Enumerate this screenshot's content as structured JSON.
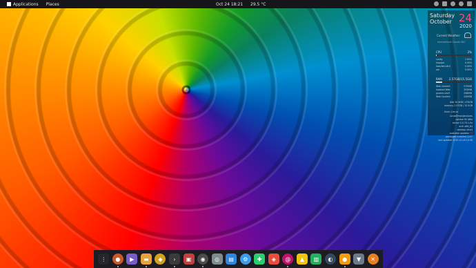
{
  "topbar": {
    "menu": [
      "Applications",
      "Places"
    ],
    "clock": "Oct 24  18:21",
    "weather": "29.5 °C"
  },
  "conky": {
    "day": "Saturday",
    "month": "October",
    "date": "24",
    "year": "2020",
    "weather_label": "Current Weather:",
    "weather_value": "Intermittent Clouds 30C",
    "cpu_label": "CPU",
    "cpu_percent": "2%",
    "cpu_fraction": 0.02,
    "procs": [
      {
        "name": "conky",
        "value": "2.60%"
      },
      {
        "name": "kswapd",
        "value": "0.00%"
      },
      {
        "name": "kworker/u8:0",
        "value": "0.00%"
      },
      {
        "name": "zsh",
        "value": "0.00%"
      }
    ],
    "ram_label": "RAM",
    "ram_value": "2.57GiB/15.5GiB",
    "ram_fraction": 0.17,
    "mem_procs": [
      {
        "name": "Web Content",
        "value": "570MiB"
      },
      {
        "name": "Isolated Web",
        "value": "353MiB"
      },
      {
        "name": "gnome-shell",
        "value": "298MiB"
      },
      {
        "name": "Web Content",
        "value": "240MiB"
      }
    ],
    "disk": "disk 30.6GB / 476GB",
    "memory": "memory 2.57GB / 15.5GB",
    "distro": "Arch Linux",
    "host": "lucas@manjarolucas",
    "uptime": "uptime 9h 48m",
    "kernel": "kernel 5.4.70-1-lts",
    "arch": "arch x86_64",
    "desktop": "desktop xfce4",
    "updates_label": "available updates",
    "updates_value": "73",
    "packages": "packages installed 1247",
    "last_updated": "last updated 2020-10-18 10:36"
  },
  "dock": {
    "items": [
      {
        "name": "app-grid-icon",
        "color": "#26262c",
        "glyph": "⋮"
      },
      {
        "name": "web-browser-icon",
        "color": "#c65a2e",
        "glyph": "●"
      },
      {
        "name": "video-app-icon",
        "color": "#7a5cc6",
        "glyph": "▶"
      },
      {
        "name": "file-manager-icon",
        "color": "#e9a23b",
        "glyph": "▬"
      },
      {
        "name": "package-manager-icon",
        "color": "#d4a11e",
        "glyph": "◆"
      },
      {
        "name": "terminal-icon",
        "color": "#3a3a3a",
        "glyph": "›"
      },
      {
        "name": "screen-recorder-icon",
        "color": "#c24040",
        "glyph": "▣"
      },
      {
        "name": "obs-icon",
        "color": "#4a4a4a",
        "glyph": "◉"
      },
      {
        "name": "disk-utility-icon",
        "color": "#7f8c8d",
        "glyph": "◎"
      },
      {
        "name": "image-viewer-icon",
        "color": "#2e86de",
        "glyph": "▤"
      },
      {
        "name": "settings-icon",
        "color": "#3d9be9",
        "glyph": "⚙"
      },
      {
        "name": "extensions-icon",
        "color": "#2ecc71",
        "glyph": "✚"
      },
      {
        "name": "software-center-icon",
        "color": "#e84c3d",
        "glyph": "◈"
      },
      {
        "name": "debian-icon",
        "color": "#c0126b",
        "glyph": "@"
      },
      {
        "name": "tux-icon",
        "color": "#f1c40f",
        "glyph": "▲"
      },
      {
        "name": "system-monitor-icon",
        "color": "#27ae60",
        "glyph": "▥"
      },
      {
        "name": "camera-icon",
        "color": "#34495e",
        "glyph": "◐"
      },
      {
        "name": "color-picker-icon",
        "color": "#f39c12",
        "glyph": "●"
      },
      {
        "name": "archive-icon",
        "color": "#6c7a89",
        "glyph": "▼"
      },
      {
        "name": "xorg-icon",
        "color": "#e67e22",
        "glyph": "✕"
      }
    ]
  }
}
